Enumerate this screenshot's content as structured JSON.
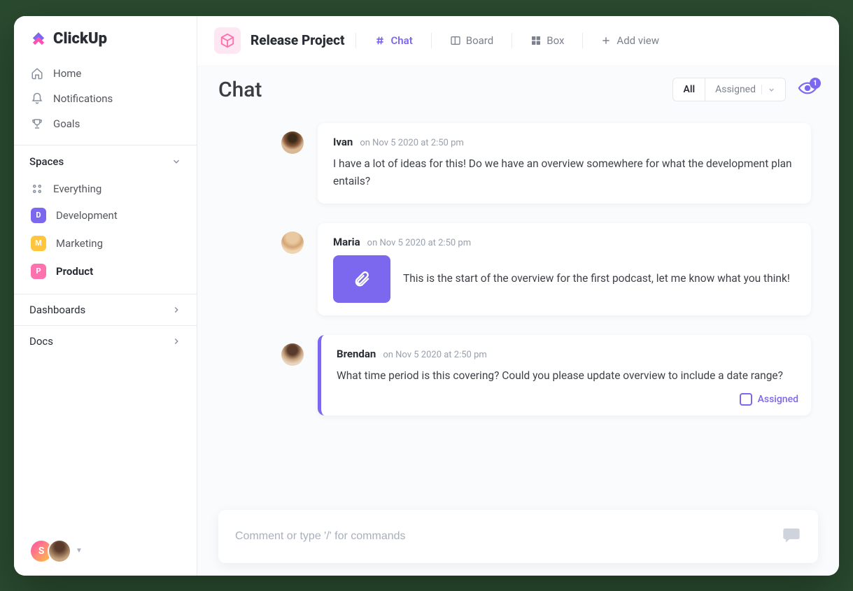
{
  "brand": {
    "name": "ClickUp"
  },
  "sidebar": {
    "nav": [
      {
        "label": "Home"
      },
      {
        "label": "Notifications"
      },
      {
        "label": "Goals"
      }
    ],
    "spaces_header": "Spaces",
    "everything_label": "Everything",
    "spaces": [
      {
        "letter": "D",
        "label": "Development",
        "color": "#7b68ee"
      },
      {
        "letter": "M",
        "label": "Marketing",
        "color": "#ffc53d"
      },
      {
        "letter": "P",
        "label": "Product",
        "color": "#fd71af"
      }
    ],
    "sections": [
      {
        "label": "Dashboards"
      },
      {
        "label": "Docs"
      }
    ],
    "footer_avatar_letter": "S"
  },
  "header": {
    "project": "Release Project",
    "tabs": [
      {
        "label": "Chat"
      },
      {
        "label": "Board"
      },
      {
        "label": "Box"
      }
    ],
    "add_view": "Add view"
  },
  "page": {
    "title": "Chat",
    "filters": {
      "all": "All",
      "assigned": "Assigned"
    },
    "watchers_count": "1"
  },
  "messages": [
    {
      "author": "Ivan",
      "timestamp": "on Nov 5 2020 at 2:50 pm",
      "body": "I have a lot of ideas for this! Do we have an overview somewhere for what the development plan entails?",
      "avatar_bg": "radial-gradient(circle at 50% 30%, #3a2a1a 20%, #8b5a3a 42%, #d9b896 60%)"
    },
    {
      "author": "Maria",
      "timestamp": "on Nov 5 2020 at 2:50 pm",
      "body": "This is the start of the overview for the first podcast, let me know what you think!",
      "has_attachment": true,
      "avatar_bg": "radial-gradient(circle at 50% 25%, #e8c9a0 30%, #d4a574 50%, #f0d5b5 70%)"
    },
    {
      "author": "Brendan",
      "timestamp": "on Nov 5 2020 at 2:50 pm",
      "body": "What time period is this covering? Could you please update overview to include a date range?",
      "assigned": true,
      "assigned_label": "Assigned",
      "avatar_bg": "radial-gradient(circle at 50% 30%, #5a3a2a 25%, #c9a580 50%, #e8d5c0 70%)"
    }
  ],
  "composer": {
    "placeholder": "Comment or type '/' for commands"
  }
}
